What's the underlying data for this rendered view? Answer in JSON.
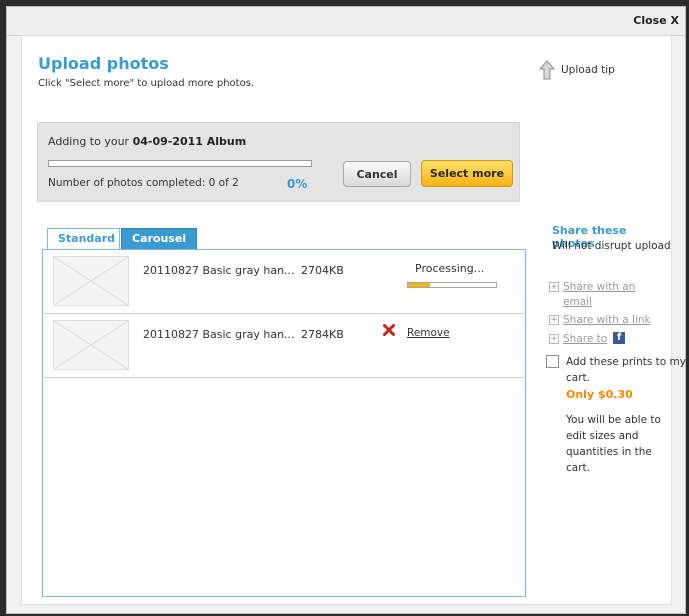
{
  "dialog": {
    "close_label": "Close X"
  },
  "header": {
    "title": "Upload photos",
    "subtitle": "Click \"Select more\" to upload more photos.",
    "upload_tip": "Upload tip"
  },
  "status_panel": {
    "adding_prefix": "Adding to your ",
    "album_name": "04-09-2011 Album",
    "completed_text": "Number of photos completed: 0 of 2",
    "percent": "0%",
    "progress_fraction": 0,
    "cancel_label": "Cancel",
    "select_more_label": "Select more"
  },
  "tabs": [
    {
      "label": "Standard",
      "active": true
    },
    {
      "label": "Carousel",
      "active": false
    }
  ],
  "files": [
    {
      "name": "20110827 Basic gray han...",
      "size": "2704KB",
      "status": "Processing...",
      "progress_fraction": 0.25
    },
    {
      "name": "20110827 Basic gray han...",
      "size": "2784KB",
      "action": "Remove"
    }
  ],
  "share": {
    "title": "Share these photos",
    "subtitle": "Will not disrupt upload",
    "options": [
      "Share with an email",
      "Share with a link",
      "Share to"
    ],
    "facebook_glyph": "f"
  },
  "prints": {
    "checkbox_label": "Add these prints to my cart.",
    "price": "Only $0.30",
    "note": "You will be able to edit sizes and quantities in the cart."
  },
  "icons": {
    "upload_tip": "up-arrow-icon",
    "remove": "red-x-icon",
    "facebook": "facebook-icon",
    "thumbnail": "image-placeholder-icon"
  },
  "colors": {
    "accent_blue": "#3a9bd0",
    "select_button": "#f6b312",
    "price_orange": "#f08a00",
    "remove_red": "#c8201c",
    "processing_bar": "#f2b21a"
  }
}
